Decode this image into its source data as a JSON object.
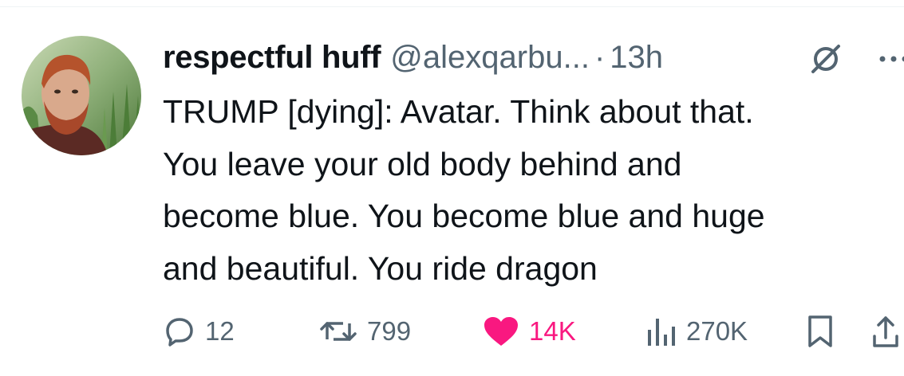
{
  "tweet": {
    "author_name": "respectful huff",
    "author_handle": "@alexqarbu...",
    "separator": "·",
    "timestamp": "13h",
    "text_lines": [
      "TRUMP [dying]: Avatar. Think about that.",
      "You leave your old body behind and",
      "become blue. You become blue and huge",
      "and beautiful. You ride dragon"
    ]
  },
  "actions": {
    "replies": "12",
    "reposts": "799",
    "likes": "14K",
    "views": "270K"
  },
  "icons": {
    "reply": "reply-icon",
    "repost": "repost-icon",
    "like": "heart-filled-icon",
    "views": "analytics-icon",
    "bookmark": "bookmark-icon",
    "share": "share-icon",
    "muted": "muted-icon",
    "more": "more-icon"
  },
  "colors": {
    "text": "#0f1419",
    "secondary": "#536471",
    "like": "#f91880"
  }
}
